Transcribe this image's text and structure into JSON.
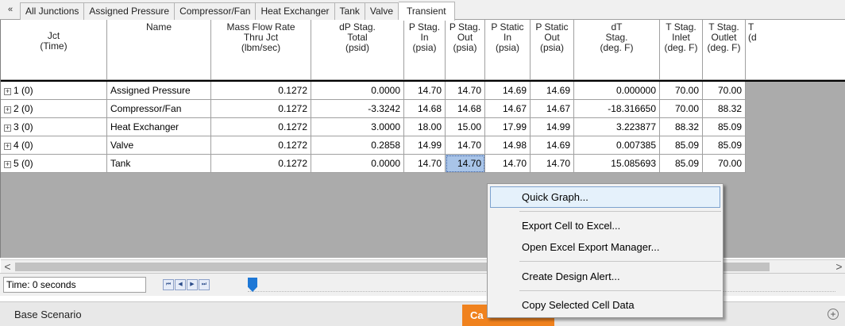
{
  "tabs": [
    {
      "label": "All Junctions"
    },
    {
      "label": "Assigned Pressure"
    },
    {
      "label": "Compressor/Fan"
    },
    {
      "label": "Heat Exchanger"
    },
    {
      "label": "Tank"
    },
    {
      "label": "Valve"
    },
    {
      "label": "Transient"
    }
  ],
  "collapse_glyph": "«",
  "columns": [
    {
      "header": "Jct\n(Time)"
    },
    {
      "header": "Name"
    },
    {
      "header": "Mass Flow Rate\nThru Jct\n(lbm/sec)"
    },
    {
      "header": "dP Stag.\nTotal\n(psid)"
    },
    {
      "header": "P Stag.\nIn\n(psia)"
    },
    {
      "header": "P Stag.\nOut\n(psia)"
    },
    {
      "header": "P Static\nIn\n(psia)"
    },
    {
      "header": "P Static\nOut\n(psia)"
    },
    {
      "header": "dT\nStag.\n(deg. F)"
    },
    {
      "header": "T Stag.\nInlet\n(deg. F)"
    },
    {
      "header": "T Stag.\nOutlet\n(deg. F)"
    },
    {
      "header": "T\n(d"
    }
  ],
  "rows": [
    {
      "jct": "1 (0)",
      "name": "Assigned Pressure",
      "mass_flow": "0.1272",
      "dp_stag": "0.0000",
      "p_stag_in": "14.70",
      "p_stag_out": "14.70",
      "p_static_in": "14.69",
      "p_static_out": "14.69",
      "dt_stag": "0.000000",
      "t_stag_inlet": "70.00",
      "t_stag_outlet": "70.00"
    },
    {
      "jct": "2 (0)",
      "name": "Compressor/Fan",
      "mass_flow": "0.1272",
      "dp_stag": "-3.3242",
      "p_stag_in": "14.68",
      "p_stag_out": "14.68",
      "p_static_in": "14.67",
      "p_static_out": "14.67",
      "dt_stag": "-18.316650",
      "t_stag_inlet": "70.00",
      "t_stag_outlet": "88.32"
    },
    {
      "jct": "3 (0)",
      "name": "Heat Exchanger",
      "mass_flow": "0.1272",
      "dp_stag": "3.0000",
      "p_stag_in": "18.00",
      "p_stag_out": "15.00",
      "p_static_in": "17.99",
      "p_static_out": "14.99",
      "dt_stag": "3.223877",
      "t_stag_inlet": "88.32",
      "t_stag_outlet": "85.09"
    },
    {
      "jct": "4 (0)",
      "name": "Valve",
      "mass_flow": "0.1272",
      "dp_stag": "0.2858",
      "p_stag_in": "14.99",
      "p_stag_out": "14.70",
      "p_static_in": "14.98",
      "p_static_out": "14.69",
      "dt_stag": "0.007385",
      "t_stag_inlet": "85.09",
      "t_stag_outlet": "85.09"
    },
    {
      "jct": "5 (0)",
      "name": "Tank",
      "mass_flow": "0.1272",
      "dp_stag": "0.0000",
      "p_stag_in": "14.70",
      "p_stag_out": "14.70",
      "p_static_in": "14.70",
      "p_static_out": "14.70",
      "dt_stag": "15.085693",
      "t_stag_inlet": "85.09",
      "t_stag_outlet": "70.00"
    }
  ],
  "expand_glyph": "+",
  "scroll": {
    "left": "<",
    "right": ">"
  },
  "time_label": "Time: 0 seconds",
  "playback_buttons": [
    "⏮",
    "◀",
    "▶",
    "⏭"
  ],
  "scenario": "Base Scenario",
  "orange_label": "Ca",
  "context_menu": {
    "quick_graph": "Quick Graph...",
    "export_cell": "Export Cell to Excel...",
    "open_export_manager": "Open Excel Export Manager...",
    "create_alert": "Create Design Alert...",
    "copy_cell": "Copy Selected Cell Data"
  },
  "colors": {
    "selection": "#a8c4e8",
    "menu_highlight": "#e5f1fb",
    "orange": "#f0821e",
    "slider": "#1e78d6"
  }
}
